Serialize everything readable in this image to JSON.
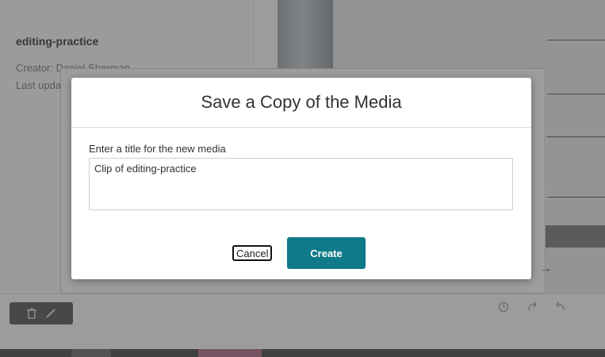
{
  "background": {
    "media_title": "editing-practice",
    "creator_label": "Creator:",
    "creator_name": "Daniel Sherman",
    "last_updated_label": "Last update",
    "icons": [
      "delete-icon",
      "edit-icon",
      "history-icon",
      "redo-icon",
      "undo-icon",
      "arrow-right-icon"
    ]
  },
  "modal": {
    "title": "Save a Copy of the Media",
    "field_label": "Enter a title for the new media",
    "field_value": "Clip of editing-practice",
    "cancel_label": "Cancel",
    "create_label": "Create"
  },
  "colors": {
    "primary_button": "#0f7a8a",
    "backdrop": "rgba(60,60,60,0.5)"
  }
}
